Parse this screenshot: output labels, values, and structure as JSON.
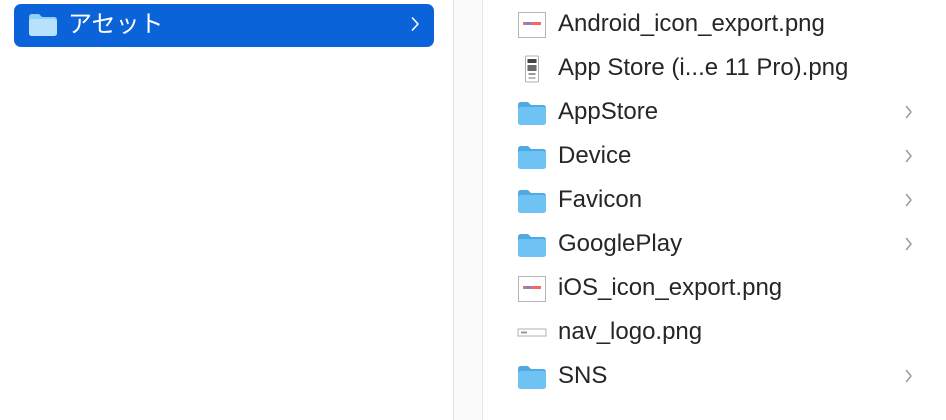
{
  "sidebar": {
    "selected_folder": {
      "label": "アセット",
      "icon": "folder-icon"
    }
  },
  "files": [
    {
      "name": "Android_icon_export.png",
      "kind": "image",
      "icon": "image-file-icon",
      "has_chevron": false
    },
    {
      "name": "App Store (i...e 11 Pro).png",
      "kind": "screenshot",
      "icon": "phone-screenshot-icon",
      "has_chevron": false
    },
    {
      "name": "AppStore",
      "kind": "folder",
      "icon": "folder-icon",
      "has_chevron": true
    },
    {
      "name": "Device",
      "kind": "folder",
      "icon": "folder-icon",
      "has_chevron": true
    },
    {
      "name": "Favicon",
      "kind": "folder",
      "icon": "folder-icon",
      "has_chevron": true
    },
    {
      "name": "GooglePlay",
      "kind": "folder",
      "icon": "folder-icon",
      "has_chevron": true
    },
    {
      "name": "iOS_icon_export.png",
      "kind": "image",
      "icon": "image-file-icon",
      "has_chevron": false
    },
    {
      "name": "nav_logo.png",
      "kind": "banner",
      "icon": "banner-file-icon",
      "has_chevron": false
    },
    {
      "name": "SNS",
      "kind": "folder",
      "icon": "folder-icon",
      "has_chevron": true
    }
  ],
  "colors": {
    "selection": "#0a63d8",
    "folder_body": "#6fc2f4",
    "folder_tab": "#4fa9e4",
    "text": "#262626",
    "chevron": "#9a9a9a"
  }
}
